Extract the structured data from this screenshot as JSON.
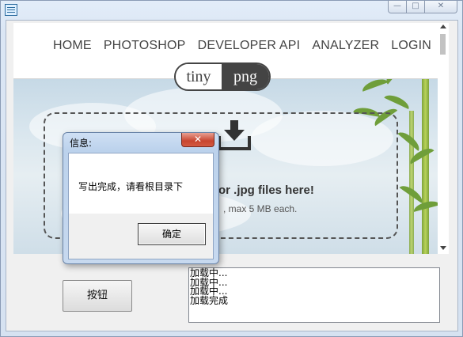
{
  "window": {
    "controls": {
      "minimize": "—",
      "maximize": "□",
      "close": "✕"
    }
  },
  "browser": {
    "nav": [
      "HOME",
      "PHOTOSHOP",
      "DEVELOPER API",
      "ANALYZER",
      "LOGIN"
    ],
    "logo": {
      "left": "tiny",
      "right": "png"
    },
    "dropzone": {
      "title": "or .jpg files here!",
      "subtitle": ", max 5 MB each."
    }
  },
  "controls": {
    "button_label": "按钮",
    "log_lines": [
      "加载中...",
      "加载中...",
      "加载中...",
      "加载完成"
    ]
  },
  "dialog": {
    "title": "信息:",
    "close": "✕",
    "message": "写出完成，请看根目录下",
    "ok_label": "确定"
  },
  "colors": {
    "dialog_frame": "#c7d9ef",
    "close_button": "#c8452f",
    "bamboo": "#6f9e3a"
  }
}
